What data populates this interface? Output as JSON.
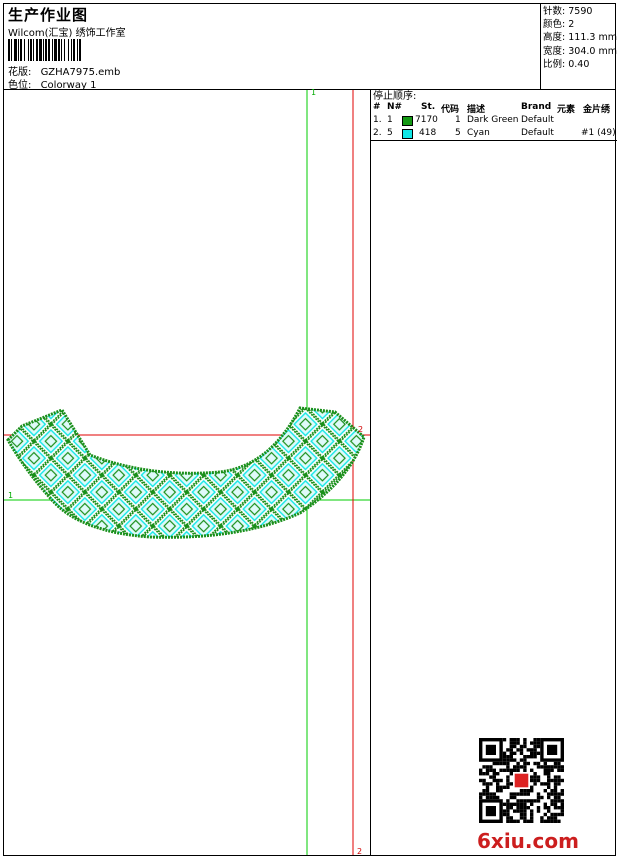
{
  "header": {
    "title": "生产作业图",
    "company": "Wilcom(汇宝) 绣饰工作室",
    "design_label": "花版:",
    "design_file": "GZHA7975.emb",
    "colorway_label": "色位:",
    "colorway": "Colorway 1"
  },
  "stats": [
    {
      "label": "针数:",
      "value": "7590"
    },
    {
      "label": "颜色:",
      "value": "2"
    },
    {
      "label": "高度:",
      "value": "111.3 mm"
    },
    {
      "label": "宽度:",
      "value": "304.0 mm"
    },
    {
      "label": "比例:",
      "value": "0.40"
    }
  ],
  "stop_sequence": {
    "title": "停止顺序:",
    "headers": {
      "num": "#",
      "n": "N#",
      "st": "St.",
      "code": "代码",
      "desc": "描述",
      "brand": "Brand",
      "element": "元素",
      "sequin": "金片绣"
    },
    "rows": [
      {
        "num": "1.",
        "n": "1",
        "color": "#149914",
        "st": "7170",
        "code": "1",
        "desc": "Dark Green",
        "brand": "Default",
        "sequin": ""
      },
      {
        "num": "2.",
        "n": "5",
        "color": "#10e6e6",
        "st": "418",
        "code": "5",
        "desc": "Cyan",
        "brand": "Default",
        "sequin": "#1 (49)"
      }
    ]
  },
  "axes": {
    "green_1_top": "1",
    "green_1_left": "1",
    "red_2_right": "2",
    "red_2_bottom": "2"
  },
  "colors": {
    "thread_green": "#1a8f1a",
    "thread_cyan": "#10e6e6",
    "guide_green": "#00d000",
    "guide_red": "#e00000"
  },
  "watermark": "6xiu.com"
}
